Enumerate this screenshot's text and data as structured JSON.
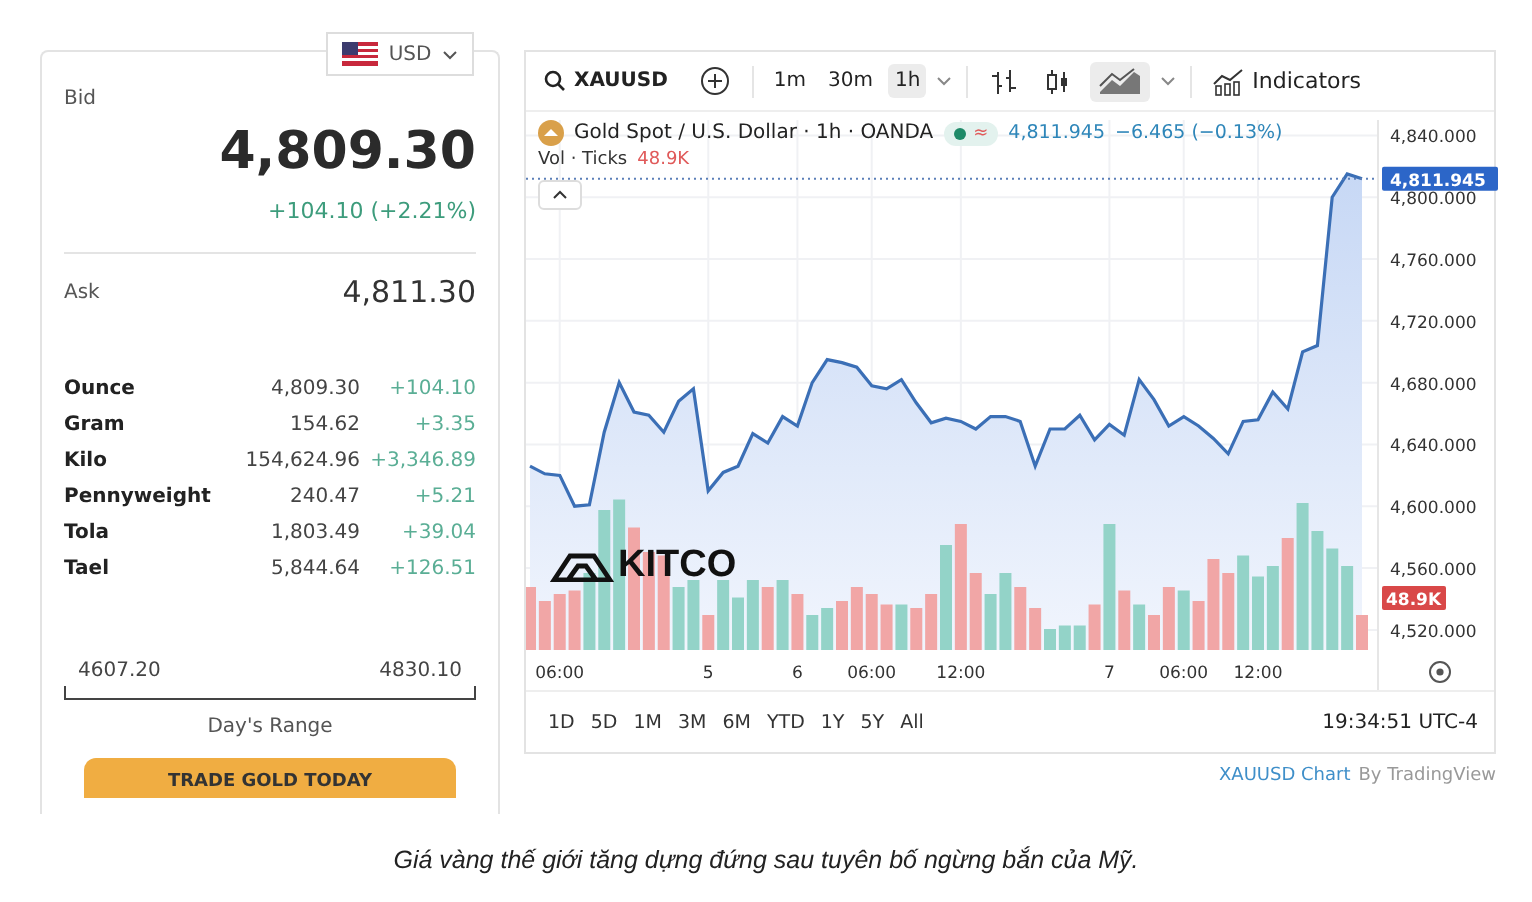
{
  "currency_select": {
    "label": "USD"
  },
  "quote": {
    "bid_label": "Bid",
    "bid": "4,809.30",
    "change": "+104.10 (+2.21%)",
    "ask_label": "Ask",
    "ask": "4,811.30"
  },
  "units": [
    {
      "name": "Ounce",
      "price": "4,809.30",
      "change": "+104.10"
    },
    {
      "name": "Gram",
      "price": "154.62",
      "change": "+3.35"
    },
    {
      "name": "Kilo",
      "price": "154,624.96",
      "change": "+3,346.89"
    },
    {
      "name": "Pennyweight",
      "price": "240.47",
      "change": "+5.21"
    },
    {
      "name": "Tola",
      "price": "1,803.49",
      "change": "+39.04"
    },
    {
      "name": "Tael",
      "price": "5,844.64",
      "change": "+126.51"
    }
  ],
  "day_range": {
    "low": "4607.20",
    "high": "4830.10",
    "label": "Day's Range"
  },
  "trade_button": "TRADE GOLD TODAY",
  "chart_widget": {
    "symbol": "XAUUSD",
    "intervals": [
      {
        "label": "1m",
        "selected": false
      },
      {
        "label": "30m",
        "selected": false
      },
      {
        "label": "1h",
        "selected": true
      }
    ],
    "chart_styles": [
      {
        "kind": "bars",
        "selected": false
      },
      {
        "kind": "candles",
        "selected": false
      },
      {
        "kind": "area",
        "selected": true
      }
    ],
    "indicators_label": "Indicators",
    "legend": {
      "title": "Gold Spot / U.S. Dollar · 1h · OANDA",
      "status_symbol": "≈",
      "price": "4,811.945",
      "change": "−6.465 (−0.13%)",
      "vol_label": "Vol · Ticks",
      "vol_value": "48.9K"
    },
    "price_tag": "4,811.945",
    "volume_tag": "48.9K",
    "logo_text": "KITCO",
    "chart_data": {
      "type": "area",
      "categories": [
        null,
        null,
        "06:00",
        null,
        null,
        null,
        null,
        null,
        null,
        null,
        null,
        null,
        "5",
        null,
        null,
        null,
        null,
        null,
        "6",
        null,
        null,
        null,
        null,
        "06:00",
        null,
        null,
        null,
        null,
        null,
        "12:00",
        null,
        null,
        null,
        null,
        null,
        null,
        null,
        null,
        null,
        "7",
        null,
        null,
        null,
        null,
        "06:00",
        null,
        null,
        null,
        null,
        "12:00",
        null,
        null,
        null,
        null,
        null,
        null,
        null
      ],
      "series": [
        {
          "color": "#3b6fb6",
          "values": [
            4626,
            4621,
            4620,
            4600,
            4601,
            4648,
            4680,
            4661,
            4659,
            4648,
            4668,
            4676,
            4610,
            4622,
            4626,
            4647,
            4641,
            4658,
            4652,
            4680,
            4695,
            4693,
            4690,
            4678,
            4676,
            4682,
            4667,
            4654,
            4657,
            4655,
            4650,
            4658,
            4658,
            4655,
            4626,
            4650,
            4650,
            4659,
            4643,
            4653,
            4646,
            4682,
            4669,
            4652,
            4658,
            4652,
            4644,
            4634,
            4655,
            4656,
            4674,
            4663,
            4700,
            4704,
            4800,
            4815,
            4812
          ]
        }
      ],
      "ylim": [
        4507,
        4850
      ],
      "grid": true,
      "ref_lines": [
        {
          "axis": "y",
          "value": 4811.945
        }
      ],
      "yticks": [
        {
          "value": 4520,
          "label": "4,520.000"
        },
        {
          "value": 4560,
          "label": "4,560.000"
        },
        {
          "value": 4600,
          "label": "4,600.000"
        },
        {
          "value": 4640,
          "label": "4,640.000"
        },
        {
          "value": 4680,
          "label": "4,680.000"
        },
        {
          "value": 4720,
          "label": "4,720.000"
        },
        {
          "value": 4760,
          "label": "4,760.000"
        },
        {
          "value": 4800,
          "label": "4,800.000"
        },
        {
          "value": 4840,
          "label": "4,840.000"
        }
      ]
    },
    "ranges": [
      "1D",
      "5D",
      "1M",
      "3M",
      "6M",
      "YTD",
      "1Y",
      "5Y",
      "All"
    ],
    "clock": "19:34:51 UTC-4",
    "credit": {
      "link": "XAUUSD Chart",
      "by": "By TradingView"
    }
  },
  "caption": "Giá vàng thế giới tăng dựng đứng sau tuyên bố ngừng bắn của Mỹ."
}
